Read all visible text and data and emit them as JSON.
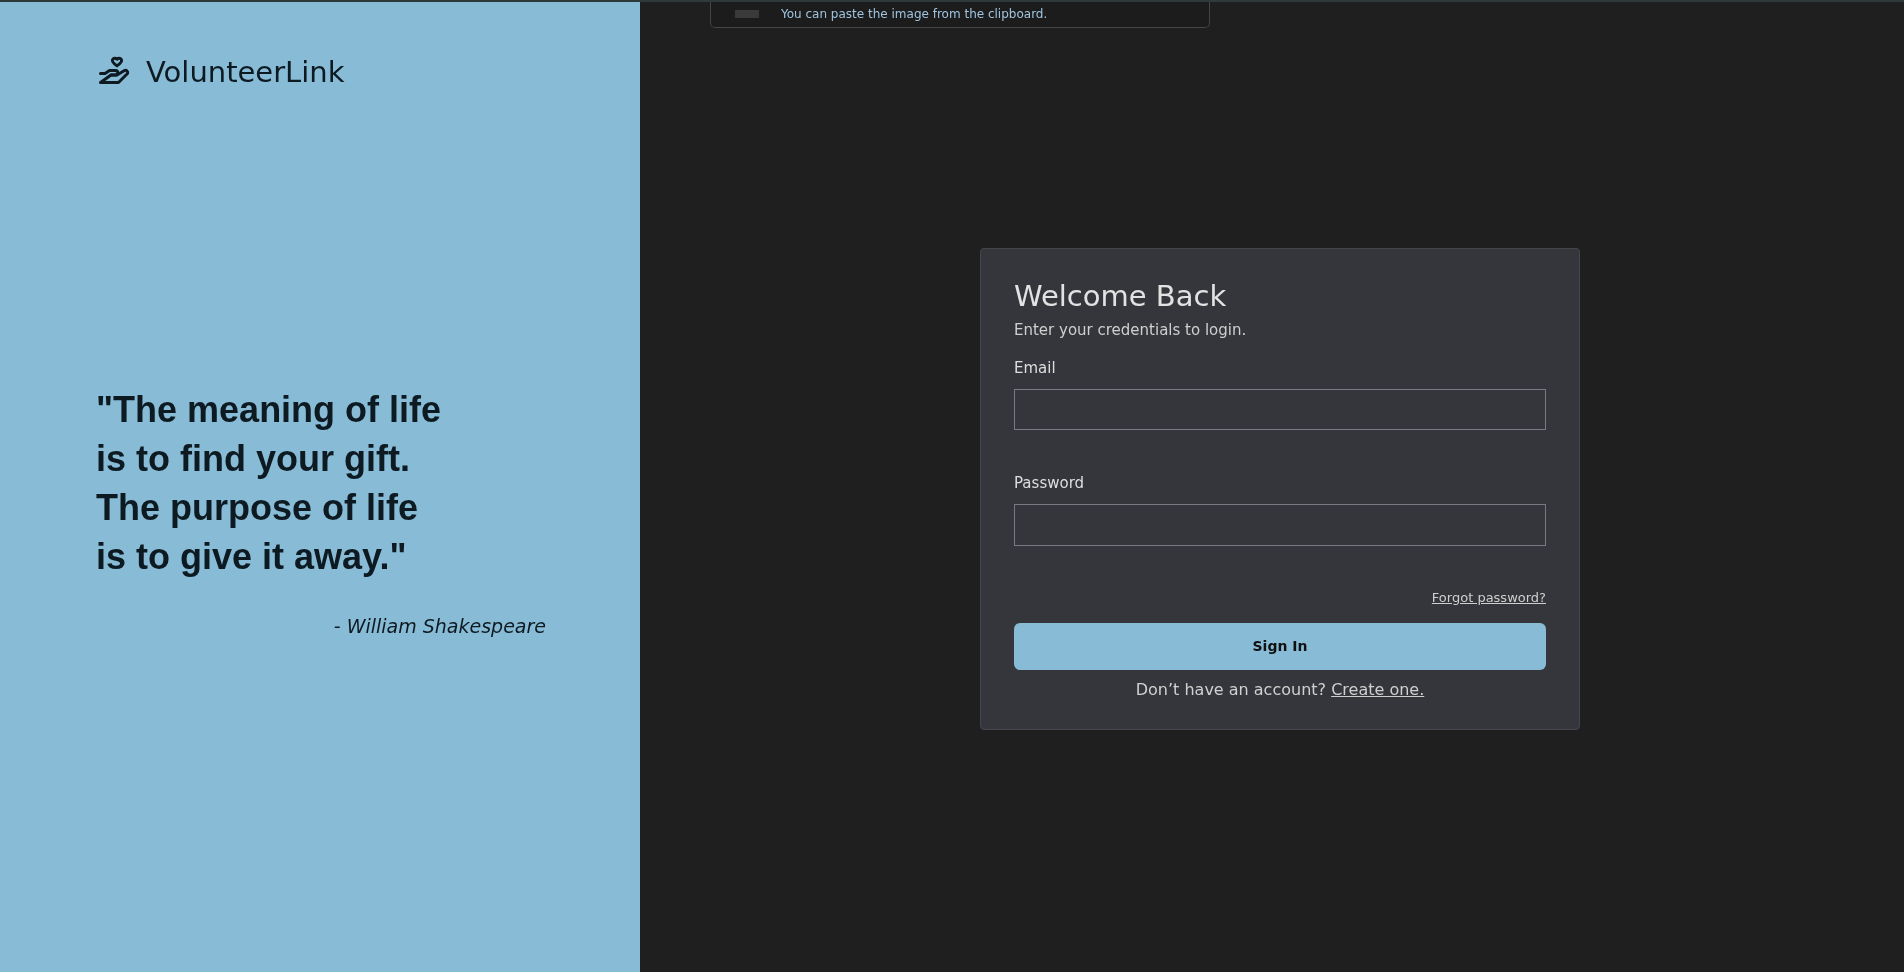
{
  "toast": {
    "message": "You can paste the image from the clipboard."
  },
  "brand": {
    "name": "VolunteerLink"
  },
  "quote": {
    "lines": [
      "\"The meaning of life",
      "is to find your gift.",
      "The purpose of life",
      "is to give it away.\""
    ],
    "author": "- William Shakespeare"
  },
  "login": {
    "title": "Welcome Back",
    "subtitle": "Enter your credentials to login.",
    "fields": [
      {
        "label": "Email"
      },
      {
        "label": "Password"
      }
    ],
    "forgot_link": "Forgot password?",
    "submit": "Sign In",
    "signup_prompt": "Don’t have an account?",
    "signup_link": "Create one."
  }
}
